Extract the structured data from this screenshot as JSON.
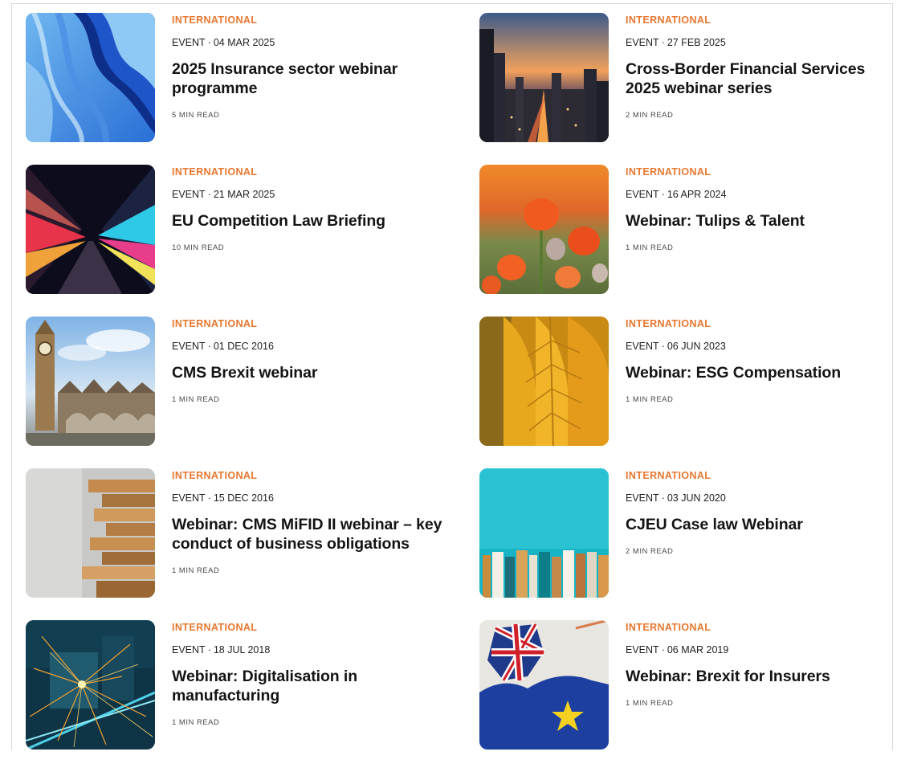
{
  "cards": [
    {
      "category": "INTERNATIONAL",
      "type": "EVENT",
      "date": "04 MAR 2025",
      "title": "2025 Insurance sector webinar programme",
      "read": "5 MIN READ",
      "image": "blue-marble-swirl"
    },
    {
      "category": "INTERNATIONAL",
      "type": "EVENT",
      "date": "27 FEB 2025",
      "title": "Cross-Border Financial Services 2025 webinar series",
      "read": "2 MIN READ",
      "image": "city-skyline-dusk"
    },
    {
      "category": "INTERNATIONAL",
      "type": "EVENT",
      "date": "21 MAR 2025",
      "title": "EU Competition Law Briefing",
      "read": "10 MIN READ",
      "image": "light-trails-street"
    },
    {
      "category": "INTERNATIONAL",
      "type": "EVENT",
      "date": "16 APR 2024",
      "title": "Webinar: Tulips & Talent",
      "read": "1 MIN READ",
      "image": "orange-tulips"
    },
    {
      "category": "INTERNATIONAL",
      "type": "EVENT",
      "date": "01 DEC 2016",
      "title": "CMS Brexit webinar",
      "read": "1 MIN READ",
      "image": "big-ben-westminster"
    },
    {
      "category": "INTERNATIONAL",
      "type": "EVENT",
      "date": "06 JUN 2023",
      "title": "Webinar: ESG Compensation",
      "read": "1 MIN READ",
      "image": "autumn-leaf"
    },
    {
      "category": "INTERNATIONAL",
      "type": "EVENT",
      "date": "15 DEC 2016",
      "title": "Webinar: CMS MiFID II webinar – key conduct of business obligations",
      "read": "1 MIN READ",
      "image": "wooden-block-tower"
    },
    {
      "category": "INTERNATIONAL",
      "type": "EVENT",
      "date": "03 JUN 2020",
      "title": "CJEU Case law Webinar",
      "read": "2 MIN READ",
      "image": "books-on-teal"
    },
    {
      "category": "INTERNATIONAL",
      "type": "EVENT",
      "date": "18 JUL 2018",
      "title": "Webinar: Digitalisation in manufacturing",
      "read": "1 MIN READ",
      "image": "welding-sparks"
    },
    {
      "category": "INTERNATIONAL",
      "type": "EVENT",
      "date": "06 MAR 2019",
      "title": "Webinar: Brexit for Insurers",
      "read": "1 MIN READ",
      "image": "uk-eu-flag-map"
    }
  ],
  "colors": {
    "category_accent": "#e8772e",
    "title": "#141414"
  }
}
